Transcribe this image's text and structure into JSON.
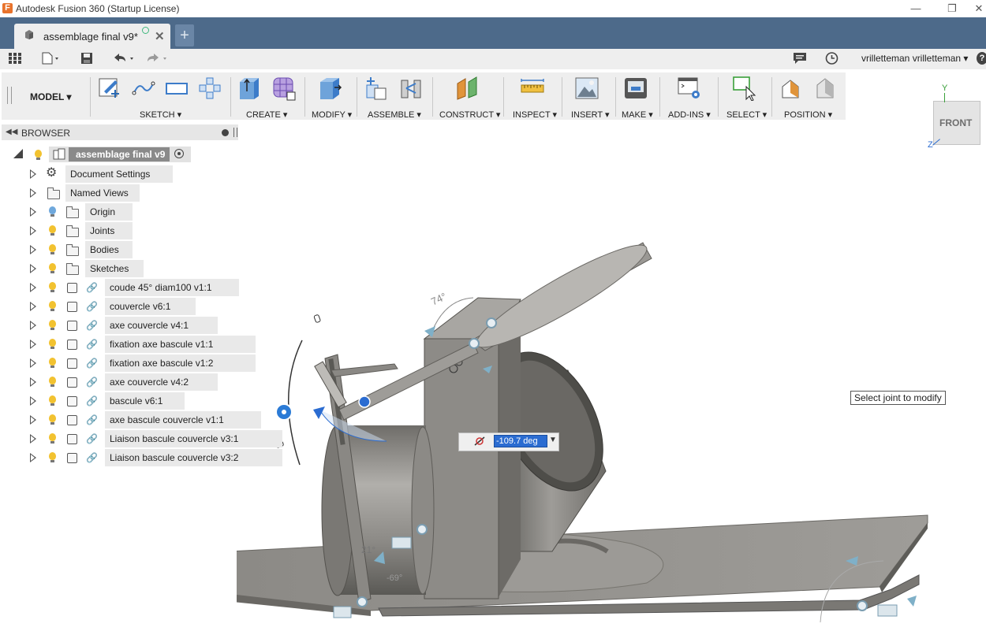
{
  "window": {
    "title": "Autodesk Fusion 360 (Startup License)",
    "controls": [
      "—",
      "❐",
      "✕"
    ]
  },
  "tabs": {
    "active_label": "assemblage final v9*",
    "close_glyph": "✕",
    "new_tab_glyph": "+"
  },
  "quickbar": {
    "user": "vrilletteman vrilletteman ▾",
    "help": "?"
  },
  "toolbar": {
    "workspace": "MODEL ▾",
    "groups": [
      "SKETCH ▾",
      "CREATE ▾",
      "MODIFY ▾",
      "ASSEMBLE ▾",
      "CONSTRUCT ▾",
      "INSPECT ▾",
      "INSERT ▾",
      "MAKE ▾",
      "ADD-INS ▾",
      "SELECT ▾",
      "POSITION ▾"
    ]
  },
  "browser": {
    "title": "BROWSER",
    "root": "assemblage final v9",
    "items": [
      {
        "label": "Document Settings",
        "kind": "settings"
      },
      {
        "label": "Named Views",
        "kind": "folder"
      },
      {
        "label": "Origin",
        "kind": "folder-bulb-blue"
      },
      {
        "label": "Joints",
        "kind": "folder-bulb"
      },
      {
        "label": "Bodies",
        "kind": "folder-bulb"
      },
      {
        "label": "Sketches",
        "kind": "folder-bulb"
      },
      {
        "label": "coude 45° diam100 v1:1",
        "kind": "component"
      },
      {
        "label": "couvercle v6:1",
        "kind": "component"
      },
      {
        "label": "axe couvercle v4:1",
        "kind": "component"
      },
      {
        "label": "fixation axe bascule v1:1",
        "kind": "component"
      },
      {
        "label": "fixation axe bascule v1:2",
        "kind": "component"
      },
      {
        "label": "axe couvercle v4:2",
        "kind": "component"
      },
      {
        "label": "bascule v6:1",
        "kind": "component"
      },
      {
        "label": "axe bascule couvercle v1:1",
        "kind": "component"
      },
      {
        "label": "Liaison bascule couvercle v3:1",
        "kind": "component"
      },
      {
        "label": "Liaison bascule couvercle v3:2",
        "kind": "component"
      }
    ]
  },
  "viewport": {
    "tooltip": "Select joint to modify",
    "angle_value": "-109.7 deg",
    "angle_label_top": "74°",
    "angle_label_mid": "21°",
    "angle_label_low": "-69°",
    "viewcube_face": "FRONT",
    "axis_y": "Y",
    "axis_z": "Z"
  },
  "colors": {
    "tab_strip": "#4d6a8a",
    "toolbar_bg": "#eeeeee",
    "selection_blue": "#2b6cd1",
    "bulb": "#f2c230",
    "model_gray": "#8c8a86"
  }
}
